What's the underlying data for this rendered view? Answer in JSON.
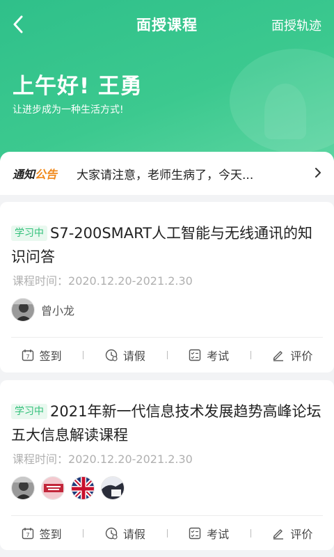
{
  "header": {
    "title": "面授课程",
    "track_label": "面授轨迹",
    "greeting": "上午好! 王勇",
    "motto": "让进步成为一种生活方式!"
  },
  "notice": {
    "tag_part1": "通知",
    "tag_part2": "公告",
    "text": "大家请注意，老师生病了，今天..."
  },
  "courses": [
    {
      "status": "学习中",
      "title": "S7-200SMART人工智能与无线通讯的知识问答",
      "time_label": "课程时间：",
      "time_range": "2020.12.20-2021.2.30",
      "teachers": [
        {
          "name": "曾小龙",
          "avatar_icon": "person-photo-icon"
        }
      ]
    },
    {
      "status": "学习中",
      "title": "2021年新一代信息技术发展趋势高峰论坛五大信息解读课程",
      "time_label": "课程时间：",
      "time_range": "2020.12.20-2021.2.30",
      "teachers": [
        {
          "avatar_icon": "person-photo-icon"
        },
        {
          "avatar_icon": "vogue-logo-icon"
        },
        {
          "avatar_icon": "union-jack-icon"
        },
        {
          "avatar_icon": "photo-icon"
        }
      ]
    }
  ],
  "actions": {
    "checkin": "签到",
    "leave": "请假",
    "exam": "考试",
    "review": "评价"
  },
  "colors": {
    "primary_green": "#3cc98f",
    "badge_text": "#31c07a",
    "notice_orange": "#f08a1d"
  }
}
